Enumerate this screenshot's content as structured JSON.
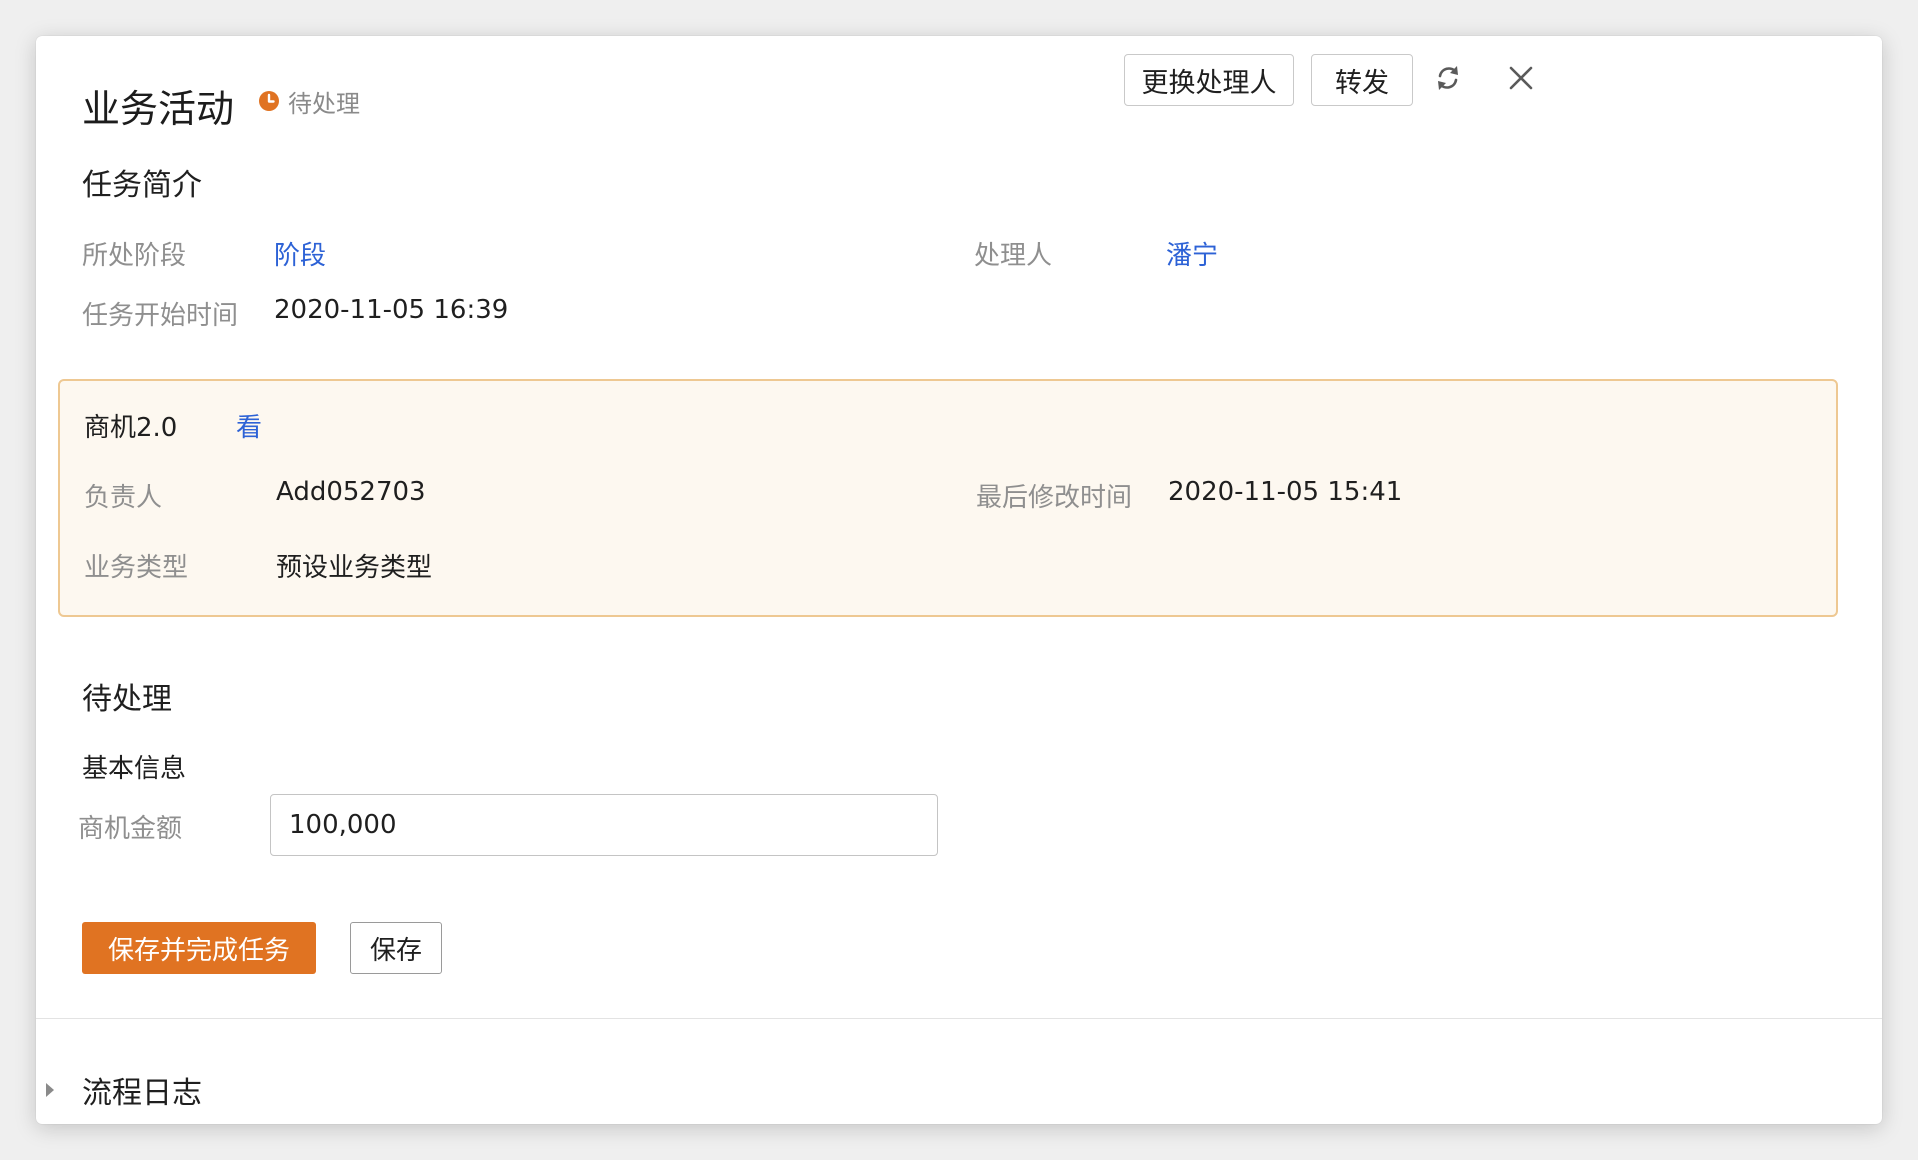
{
  "header": {
    "title": "业务活动",
    "status": "待处理",
    "status_color": "#e07322",
    "buttons": {
      "change_handler": "更换处理人",
      "forward": "转发"
    },
    "icons": [
      "refresh-icon",
      "close-icon"
    ]
  },
  "summary": {
    "title": "任务简介",
    "stage_label": "所处阶段",
    "stage_value": "阶段",
    "handler_label": "处理人",
    "handler_value": "潘宁",
    "start_time_label": "任务开始时间",
    "start_time_value": "2020-11-05 16:39"
  },
  "card": {
    "title": "商机2.0",
    "view_link": "看",
    "owner_label": "负责人",
    "owner_value": "Add052703",
    "modified_label": "最后修改时间",
    "modified_value": "2020-11-05 15:41",
    "type_label": "业务类型",
    "type_value": "预设业务类型"
  },
  "pending": {
    "title": "待处理",
    "basic_info": "基本信息",
    "amount_label": "商机金额",
    "amount_value": "100,000"
  },
  "actions": {
    "save_complete": "保存并完成任务",
    "save": "保存"
  },
  "log": {
    "title": "流程日志"
  },
  "colors": {
    "accent": "#e07322",
    "link": "#2d62d6",
    "card_bg": "#fdf8f0",
    "card_border": "#eec892"
  }
}
